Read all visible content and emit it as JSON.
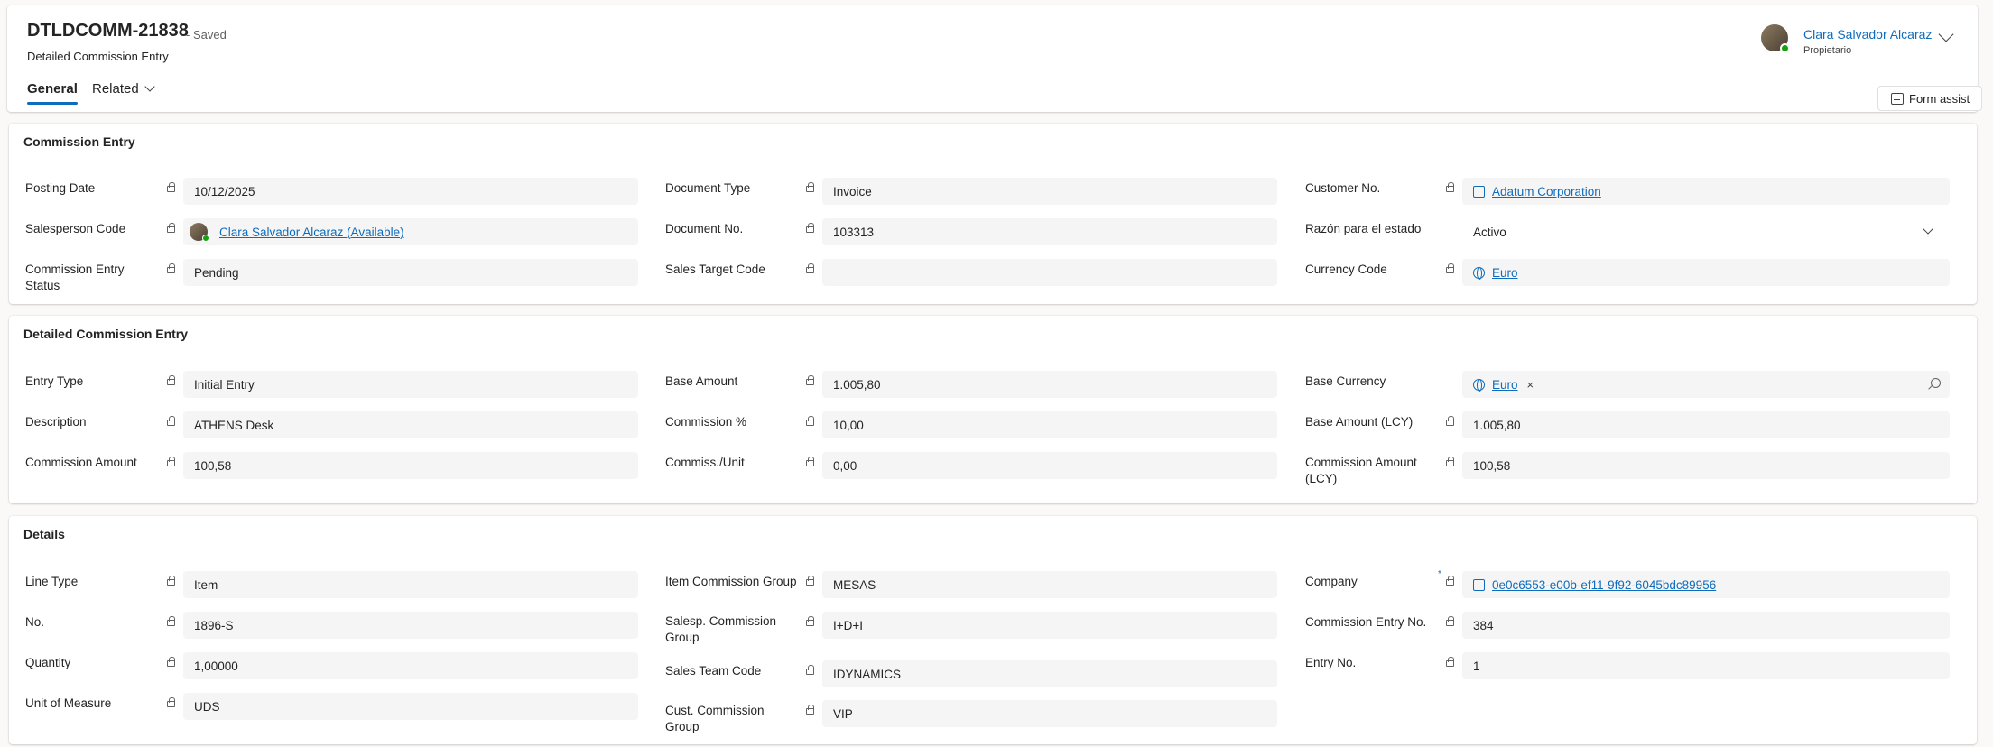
{
  "record": {
    "id": "DTLDCOMM-21838",
    "save_status": "- Saved",
    "entity": "Detailed Commission Entry",
    "tabs": [
      {
        "label": "General"
      },
      {
        "label": "Related"
      }
    ]
  },
  "owner": {
    "name": "Clara Salvador Alcaraz",
    "role": "Propietario"
  },
  "toolbar": {
    "form_assist": "Form assist"
  },
  "sections": {
    "commission_entry": {
      "title": "Commission Entry",
      "posting_date": {
        "label": "Posting Date",
        "value": "10/12/2025"
      },
      "salesperson_code": {
        "label": "Salesperson Code",
        "value": "Clara Salvador Alcaraz (Available)"
      },
      "status": {
        "label": "Commission Entry Status",
        "value": "Pending"
      },
      "document_type": {
        "label": "Document Type",
        "value": "Invoice"
      },
      "document_no": {
        "label": "Document No.",
        "value": "103313"
      },
      "sales_target_code": {
        "label": "Sales Target Code",
        "value": ""
      },
      "customer_no": {
        "label": "Customer No.",
        "value": "Adatum Corporation"
      },
      "razon_estado": {
        "label": "Razón para el estado",
        "value": "Activo"
      },
      "currency_code": {
        "label": "Currency Code",
        "value": "Euro"
      }
    },
    "detailed": {
      "title": "Detailed Commission Entry",
      "entry_type": {
        "label": "Entry Type",
        "value": "Initial Entry"
      },
      "description": {
        "label": "Description",
        "value": "ATHENS Desk"
      },
      "commission_amount": {
        "label": "Commission Amount",
        "value": "100,58"
      },
      "base_amount": {
        "label": "Base Amount",
        "value": "1.005,80"
      },
      "commission_pct": {
        "label": "Commission %",
        "value": "10,00"
      },
      "commiss_unit": {
        "label": "Commiss./Unit",
        "value": "0,00"
      },
      "base_currency": {
        "label": "Base Currency",
        "value": "Euro",
        "clear": "×"
      },
      "base_amount_lcy": {
        "label": "Base Amount (LCY)",
        "value": "1.005,80"
      },
      "commission_amount_lcy": {
        "label": "Commission Amount (LCY)",
        "value": "100,58"
      }
    },
    "details": {
      "title": "Details",
      "line_type": {
        "label": "Line Type",
        "value": "Item"
      },
      "no": {
        "label": "No.",
        "value": "1896-S"
      },
      "quantity": {
        "label": "Quantity",
        "value": "1,00000"
      },
      "uom": {
        "label": "Unit of Measure",
        "value": "UDS"
      },
      "item_commission_group": {
        "label": "Item Commission Group",
        "value": "MESAS"
      },
      "salesp_commission_group": {
        "label": "Salesp. Commission Group",
        "value": "I+D+I"
      },
      "sales_team_code": {
        "label": "Sales Team Code",
        "value": "IDYNAMICS"
      },
      "cust_commission_group": {
        "label": "Cust. Commission Group",
        "value": "VIP"
      },
      "company": {
        "label": "Company",
        "value": "0e0c6553-e00b-ef11-9f92-6045bdc89956",
        "required_marker": "*"
      },
      "commission_entry_no": {
        "label": "Commission Entry No.",
        "value": "384"
      },
      "entry_no": {
        "label": "Entry No.",
        "value": "1"
      }
    }
  }
}
